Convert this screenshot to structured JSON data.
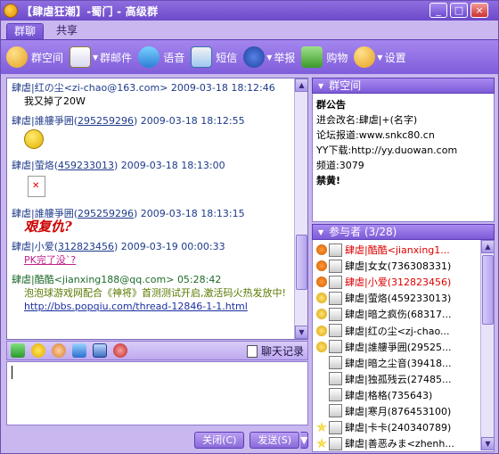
{
  "window": {
    "title": "【肆虐狂潮】-蜀门 - 高级群",
    "min": "_",
    "max": "□",
    "close": "×"
  },
  "tabs": [
    {
      "label": "群聊"
    },
    {
      "label": "共享"
    }
  ],
  "toolbar": {
    "group_space": "群空间",
    "group_mail": "群邮件",
    "voice": "语音",
    "sms": "短信",
    "report": "举报",
    "shop": "购物",
    "settings": "设置"
  },
  "chat": {
    "messages": [
      {
        "sender": "肆虐|红の尘<zi-chao@163.com>",
        "time": "2009-03-18 18:12:46",
        "body": "我又掉了20W"
      },
      {
        "sender": "肆虐|誰艛爭囲(",
        "qq": "295259296",
        "sender_end": ")",
        "time": "2009-03-18 18:12:55"
      },
      {
        "sender": "肆虐|萤烙(",
        "qq": "459233013",
        "sender_end": ")",
        "time": "2009-03-18 18:13:00"
      },
      {
        "sender": "肆虐|誰艛爭囲(",
        "qq": "295259296",
        "sender_end": ")",
        "time": "2009-03-18 18:13:15",
        "body": "艰复仇?"
      },
      {
        "sender": "肆虐|小爱(",
        "qq": "312823456",
        "sender_end": ")",
        "time": "2009-03-19 00:00:33",
        "body": "PK完了没`?"
      },
      {
        "sender": "肆虐|酷酷<jianxing188@qq.com>",
        "time": "05:28:42",
        "body": "泡泡球游戏网配合《神将》首测测试开启,激活码火热发放中!",
        "link": "http://bbs.popqiu.com/thread-12846-1-1.html"
      }
    ]
  },
  "input": {
    "history_label": "聊天记录",
    "value": ""
  },
  "buttons": {
    "close": "关闭(C)",
    "send": "发送(S)",
    "send_more": "▼"
  },
  "notice": {
    "header": "群空间",
    "lines": [
      "群公告",
      "进会改名:肆虐|+(名字)",
      "论坛报道:www.snkc80.cn",
      "YY下载:http://yy.duowan.com",
      "频道:3079",
      "禁黄!"
    ]
  },
  "members": {
    "header": "参与者 (3/28)",
    "list": [
      {
        "name": "肆虐|酷酷<jianxing1...",
        "highlight": true,
        "status": "online"
      },
      {
        "name": "肆虐|女女(736308331)",
        "highlight": false,
        "status": "online"
      },
      {
        "name": "肆虐|小爱(312823456)",
        "highlight": true,
        "status": "online"
      },
      {
        "name": "肆虐|萤烙(459233013)",
        "highlight": false,
        "status": "member"
      },
      {
        "name": "肆虐|暗之疯伤(68317...",
        "highlight": false,
        "status": "member"
      },
      {
        "name": "肆虐|红の尘<zj-chao...",
        "highlight": false,
        "status": "member"
      },
      {
        "name": "肆虐|誰艛爭囲(29525...",
        "highlight": false,
        "status": "member"
      },
      {
        "name": "肆虐|暗之尘音(39418...",
        "highlight": false,
        "status": "none"
      },
      {
        "name": "肆虐|独孤残云(27485...",
        "highlight": false,
        "status": "none"
      },
      {
        "name": "肆虐|格格(735643)",
        "highlight": false,
        "status": "none"
      },
      {
        "name": "肆虐|寒月(876453100)",
        "highlight": false,
        "status": "none"
      },
      {
        "name": "肆虐|卡卡(240340789)",
        "highlight": false,
        "status": "star"
      },
      {
        "name": "肆虐|善恶みま<zhenh...",
        "highlight": false,
        "status": "star"
      }
    ]
  },
  "colors": {
    "accent": "#7f5ddb",
    "titlebar": "#6c49c9",
    "highlight_name": "#dd0000"
  }
}
